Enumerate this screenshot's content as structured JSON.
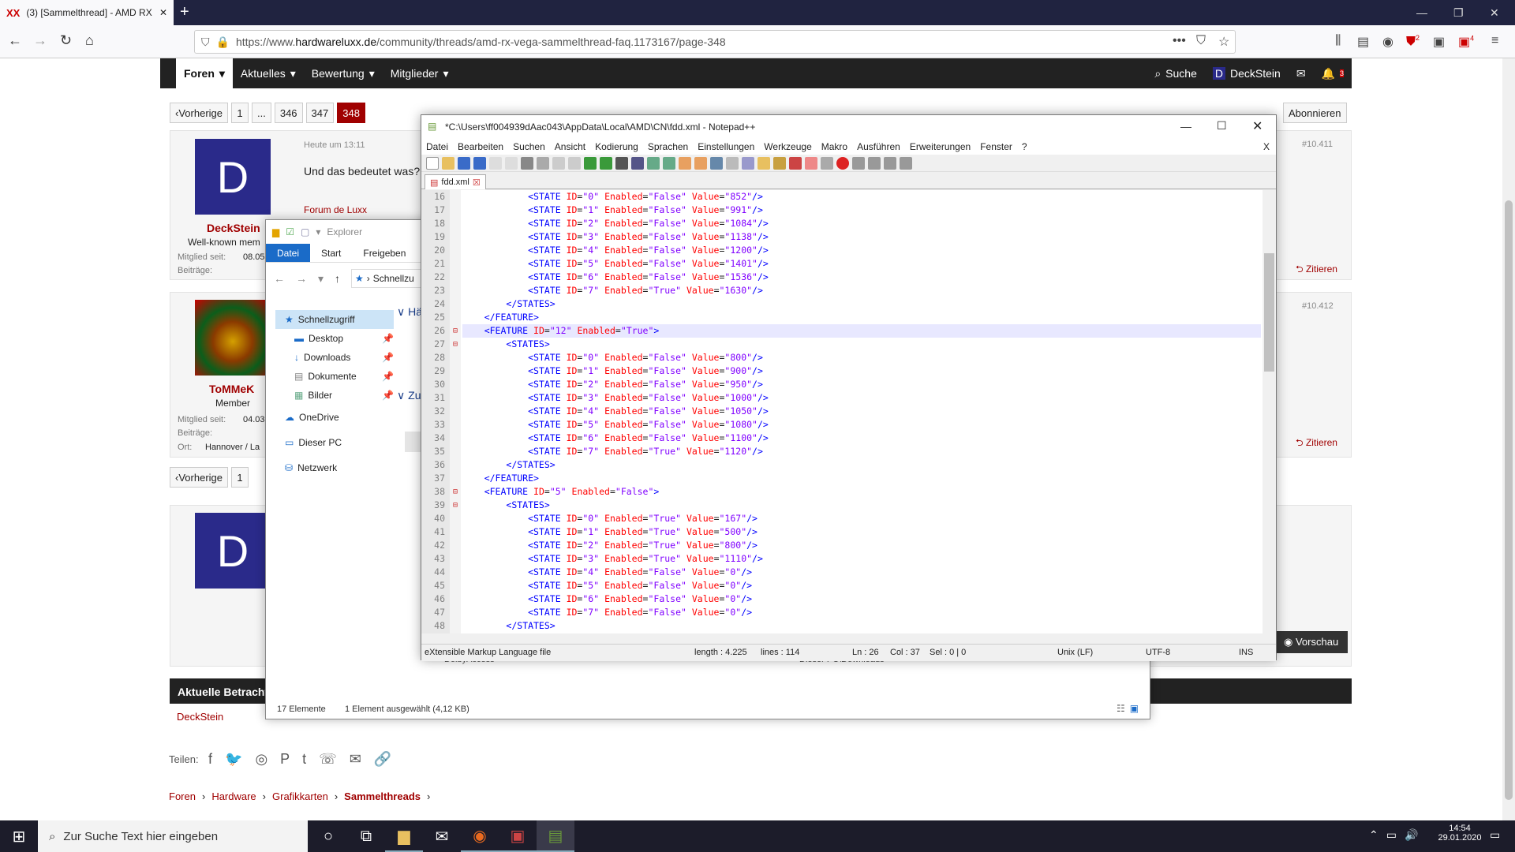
{
  "browser": {
    "tab_title": "(3) [Sammelthread] - AMD RX",
    "url_prefix": "https://www.",
    "url_domain": "hardwareluxx.de",
    "url_path": "/community/threads/amd-rx-vega-sammelthread-faq.1173167/page-348",
    "badge_ublock": "2",
    "badge_ext": "4"
  },
  "forum": {
    "nav": [
      "Foren",
      "Aktuelles",
      "Bewertung",
      "Mitglieder"
    ],
    "search": "Suche",
    "user": "DeckStein",
    "user_initial": "D",
    "notif_badge": "3",
    "pagination": {
      "prev": "Vorherige",
      "pages": [
        "1",
        "...",
        "346",
        "347",
        "348"
      ]
    },
    "subscribe": "Abonnieren",
    "post1": {
      "author": "DeckStein",
      "role": "Well-known mem",
      "since_label": "Mitglied seit:",
      "since": "08.05",
      "posts_label": "Beiträge:",
      "time": "Heute um 13:11",
      "text": "Und das bedeutet was?",
      "sig": "Forum de Luxx",
      "num": "#10.411",
      "quote": "Zitieren",
      "initial": "D"
    },
    "post2": {
      "author": "ToMMeK",
      "role": "Member",
      "since_label": "Mitglied seit:",
      "since": "04.03",
      "posts_label": "Beiträge:",
      "loc_label": "Ort:",
      "loc": "Hannover / La",
      "num": "#10.412",
      "quote": "Zitieren"
    },
    "pagination2": {
      "prev": "Vorherige",
      "pages": [
        "1"
      ]
    },
    "preview": "Vorschau",
    "current_viewers": "Aktuelle Betracht",
    "viewer": "DeckStein",
    "share": "Teilen:",
    "breadcrumb": [
      "Foren",
      "Hardware",
      "Grafikkarten",
      "Sammelthreads"
    ]
  },
  "explorer": {
    "title": "Explorer",
    "ribbon": [
      "Datei",
      "Start",
      "Freigeben"
    ],
    "address": "Schnellzu",
    "nav": [
      {
        "label": "Schnellzugriff",
        "icon": "star-icon"
      },
      {
        "label": "Desktop",
        "icon": "desktop-icon"
      },
      {
        "label": "Downloads",
        "icon": "download-icon"
      },
      {
        "label": "Dokumente",
        "icon": "document-icon"
      },
      {
        "label": "Bilder",
        "icon": "pictures-icon"
      },
      {
        "label": "OneDrive",
        "icon": "cloud-icon"
      },
      {
        "label": "Dieser PC",
        "icon": "pc-icon"
      },
      {
        "label": "Netzwerk",
        "icon": "network-icon"
      }
    ],
    "group1": "Hä",
    "group2": "Zu",
    "row_item": "DolbyAccess",
    "row_path": "Dieser PC\\Downloads",
    "status_count": "17 Elemente",
    "status_sel": "1 Element ausgewählt (4,12 KB)"
  },
  "npp": {
    "title": "*C:\\Users\\ff004939dAac043\\AppData\\Local\\AMD\\CN\\fdd.xml - Notepad++",
    "menu": [
      "Datei",
      "Bearbeiten",
      "Suchen",
      "Ansicht",
      "Kodierung",
      "Sprachen",
      "Einstellungen",
      "Werkzeuge",
      "Makro",
      "Ausführen",
      "Erweiterungen",
      "Fenster",
      "?"
    ],
    "close_x": "X",
    "tab": "fdd.xml",
    "lines": [
      {
        "n": "16",
        "i": 3,
        "k": "state",
        "id": "0",
        "en": "False",
        "v": "852"
      },
      {
        "n": "17",
        "i": 3,
        "k": "state",
        "id": "1",
        "en": "False",
        "v": "991"
      },
      {
        "n": "18",
        "i": 3,
        "k": "state",
        "id": "2",
        "en": "False",
        "v": "1084"
      },
      {
        "n": "19",
        "i": 3,
        "k": "state",
        "id": "3",
        "en": "False",
        "v": "1138"
      },
      {
        "n": "20",
        "i": 3,
        "k": "state",
        "id": "4",
        "en": "False",
        "v": "1200"
      },
      {
        "n": "21",
        "i": 3,
        "k": "state",
        "id": "5",
        "en": "False",
        "v": "1401"
      },
      {
        "n": "22",
        "i": 3,
        "k": "state",
        "id": "6",
        "en": "False",
        "v": "1536"
      },
      {
        "n": "23",
        "i": 3,
        "k": "state",
        "id": "7",
        "en": "True",
        "v": "1630"
      },
      {
        "n": "24",
        "i": 2,
        "k": "close",
        "t": "STATES"
      },
      {
        "n": "25",
        "i": 1,
        "k": "close",
        "t": "FEATURE"
      },
      {
        "n": "26",
        "i": 1,
        "k": "feature",
        "id": "12",
        "en": "True"
      },
      {
        "n": "27",
        "i": 2,
        "k": "open",
        "t": "STATES"
      },
      {
        "n": "28",
        "i": 3,
        "k": "state",
        "id": "0",
        "en": "False",
        "v": "800"
      },
      {
        "n": "29",
        "i": 3,
        "k": "state",
        "id": "1",
        "en": "False",
        "v": "900"
      },
      {
        "n": "30",
        "i": 3,
        "k": "state",
        "id": "2",
        "en": "False",
        "v": "950"
      },
      {
        "n": "31",
        "i": 3,
        "k": "state",
        "id": "3",
        "en": "False",
        "v": "1000"
      },
      {
        "n": "32",
        "i": 3,
        "k": "state",
        "id": "4",
        "en": "False",
        "v": "1050"
      },
      {
        "n": "33",
        "i": 3,
        "k": "state",
        "id": "5",
        "en": "False",
        "v": "1080"
      },
      {
        "n": "34",
        "i": 3,
        "k": "state",
        "id": "6",
        "en": "False",
        "v": "1100"
      },
      {
        "n": "35",
        "i": 3,
        "k": "state",
        "id": "7",
        "en": "True",
        "v": "1120"
      },
      {
        "n": "36",
        "i": 2,
        "k": "close",
        "t": "STATES"
      },
      {
        "n": "37",
        "i": 1,
        "k": "close",
        "t": "FEATURE"
      },
      {
        "n": "38",
        "i": 1,
        "k": "feature",
        "id": "5",
        "en": "False"
      },
      {
        "n": "39",
        "i": 2,
        "k": "open",
        "t": "STATES"
      },
      {
        "n": "40",
        "i": 3,
        "k": "state",
        "id": "0",
        "en": "True",
        "v": "167"
      },
      {
        "n": "41",
        "i": 3,
        "k": "state",
        "id": "1",
        "en": "True",
        "v": "500"
      },
      {
        "n": "42",
        "i": 3,
        "k": "state",
        "id": "2",
        "en": "True",
        "v": "800"
      },
      {
        "n": "43",
        "i": 3,
        "k": "state",
        "id": "3",
        "en": "True",
        "v": "1110"
      },
      {
        "n": "44",
        "i": 3,
        "k": "state",
        "id": "4",
        "en": "False",
        "v": "0"
      },
      {
        "n": "45",
        "i": 3,
        "k": "state",
        "id": "5",
        "en": "False",
        "v": "0"
      },
      {
        "n": "46",
        "i": 3,
        "k": "state",
        "id": "6",
        "en": "False",
        "v": "0"
      },
      {
        "n": "47",
        "i": 3,
        "k": "state",
        "id": "7",
        "en": "False",
        "v": "0"
      },
      {
        "n": "48",
        "i": 2,
        "k": "close",
        "t": "STATES"
      }
    ],
    "current_line": "26",
    "status": {
      "type": "eXtensible Markup Language file",
      "length": "length : 4.225",
      "lines": "lines : 114",
      "ln": "Ln : 26",
      "col": "Col : 37",
      "sel": "Sel : 0 | 0",
      "eol": "Unix (LF)",
      "enc": "UTF-8",
      "mode": "INS"
    }
  },
  "taskbar": {
    "search": "Zur Suche Text hier eingeben",
    "time": "14:54",
    "date": "29.01.2020"
  },
  "colors": {
    "accent": "#a00000",
    "tag": "#0000ff",
    "attr": "#ff0000",
    "value": "#8000ff"
  }
}
